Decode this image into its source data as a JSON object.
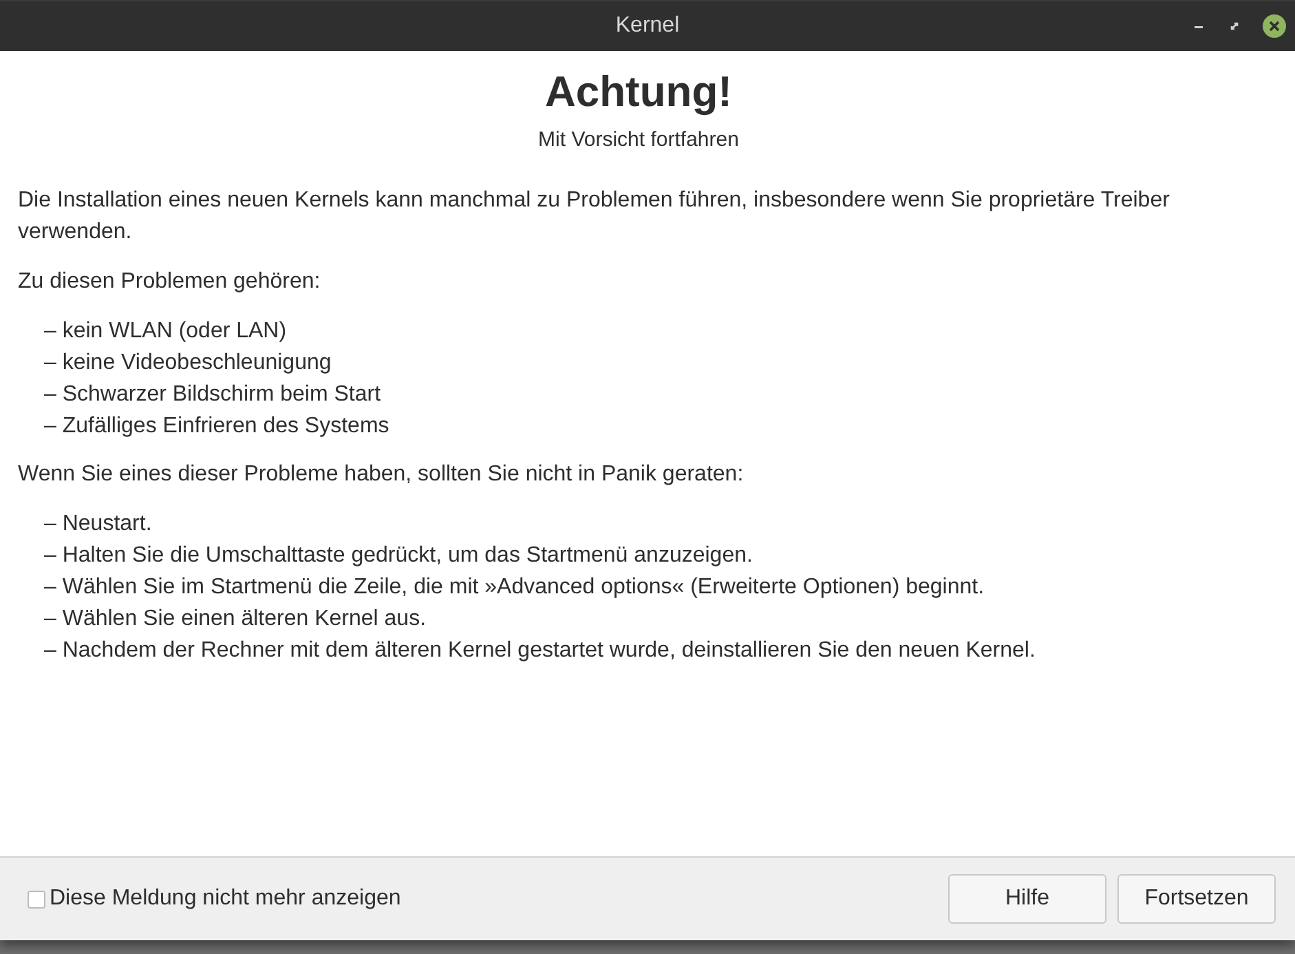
{
  "window": {
    "title": "Kernel"
  },
  "heading": "Achtung!",
  "subheading": "Mit Vorsicht fortfahren",
  "blocks": [
    {
      "kind": "paragraph",
      "text": "Die Installation eines neuen Kernels kann manchmal zu Problemen führen, insbesondere wenn Sie proprietäre Treiber verwenden."
    },
    {
      "kind": "paragraph",
      "text": "Zu diesen Problemen gehören:"
    },
    {
      "kind": "list",
      "items": [
        "– kein WLAN (oder LAN)",
        "– keine Videobeschleunigung",
        "– Schwarzer Bildschirm beim Start",
        "– Zufälliges Einfrieren des Systems"
      ]
    },
    {
      "kind": "paragraph",
      "text": "Wenn Sie eines dieser Probleme haben, sollten Sie nicht in Panik geraten:"
    },
    {
      "kind": "list",
      "items": [
        "– Neustart.",
        "– Halten Sie die Umschalttaste gedrückt, um das Startmenü anzuzeigen.",
        "– Wählen Sie im Startmenü die Zeile, die mit »Advanced options« (Erweiterte Optionen) beginnt.",
        "– Wählen Sie einen älteren Kernel aus.",
        "– Nachdem der Rechner mit dem älteren Kernel gestartet wurde, deinstallieren Sie den neuen Kernel."
      ]
    }
  ],
  "footer": {
    "checkbox": {
      "label": "Diese Meldung nicht mehr anzeigen",
      "checked": false
    },
    "buttons": [
      "Hilfe",
      "Fortsetzen"
    ]
  }
}
